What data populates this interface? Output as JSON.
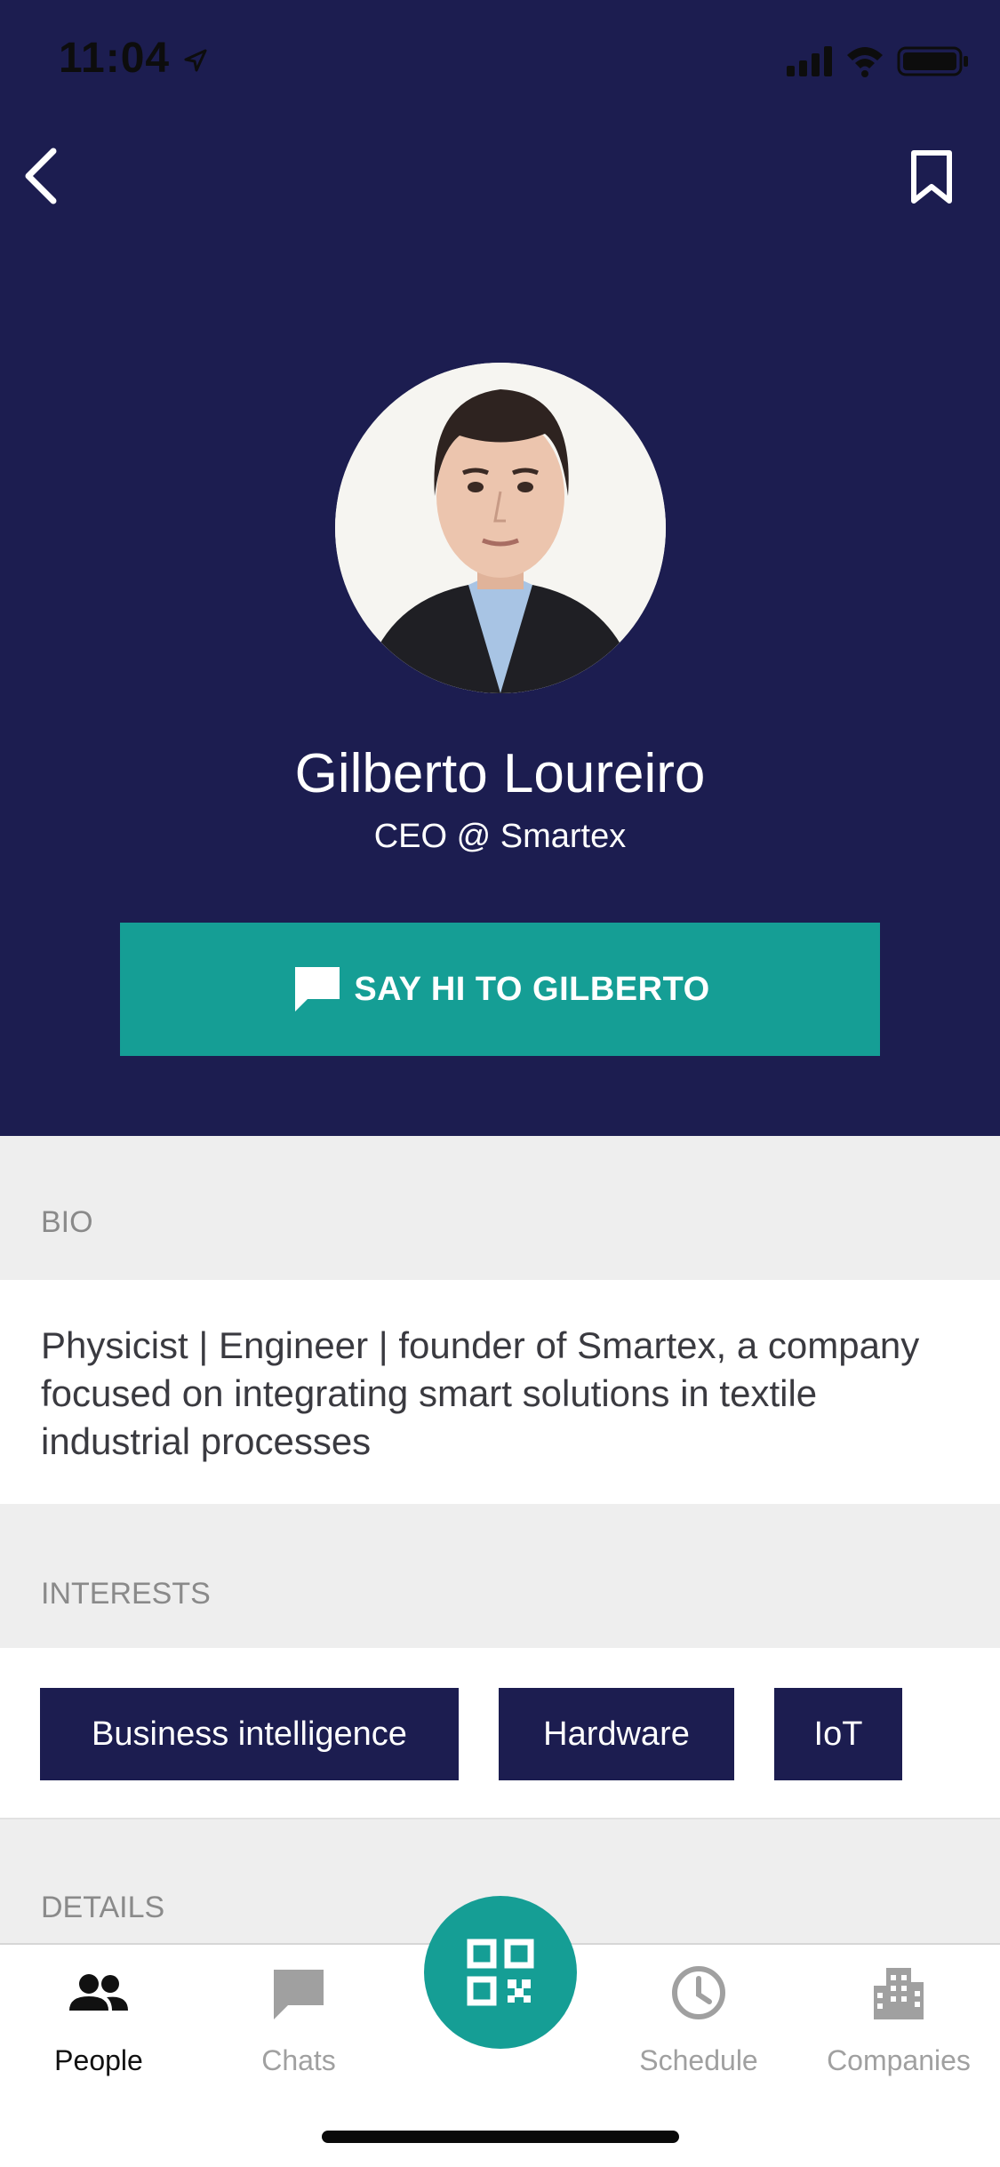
{
  "status_bar": {
    "time": "11:04"
  },
  "nav": {
    "back_icon": "chevron-left-icon",
    "bookmark_icon": "bookmark-icon"
  },
  "profile": {
    "name": "Gilberto Loureiro",
    "title": "CEO @ Smartex",
    "cta_label": "SAY HI TO GILBERTO"
  },
  "sections": {
    "bio_header": "BIO",
    "bio_text": "Physicist | Engineer | founder of Smartex, a company focused on integrating smart solutions in textile industrial processes",
    "interests_header": "INTERESTS",
    "interests": [
      "Business intelligence",
      "Hardware",
      "IoT"
    ],
    "details_header": "DETAILS"
  },
  "tabbar": {
    "tabs": [
      {
        "label": "People",
        "icon": "people-icon",
        "active": true
      },
      {
        "label": "Chats",
        "icon": "chat-icon",
        "active": false
      },
      {
        "label": "Schedule",
        "icon": "clock-icon",
        "active": false
      },
      {
        "label": "Companies",
        "icon": "building-icon",
        "active": false
      }
    ],
    "fab_icon": "qr-code-icon"
  },
  "colors": {
    "navy": "#1c1d50",
    "teal": "#159e95",
    "section_gray": "#eeeeee"
  }
}
